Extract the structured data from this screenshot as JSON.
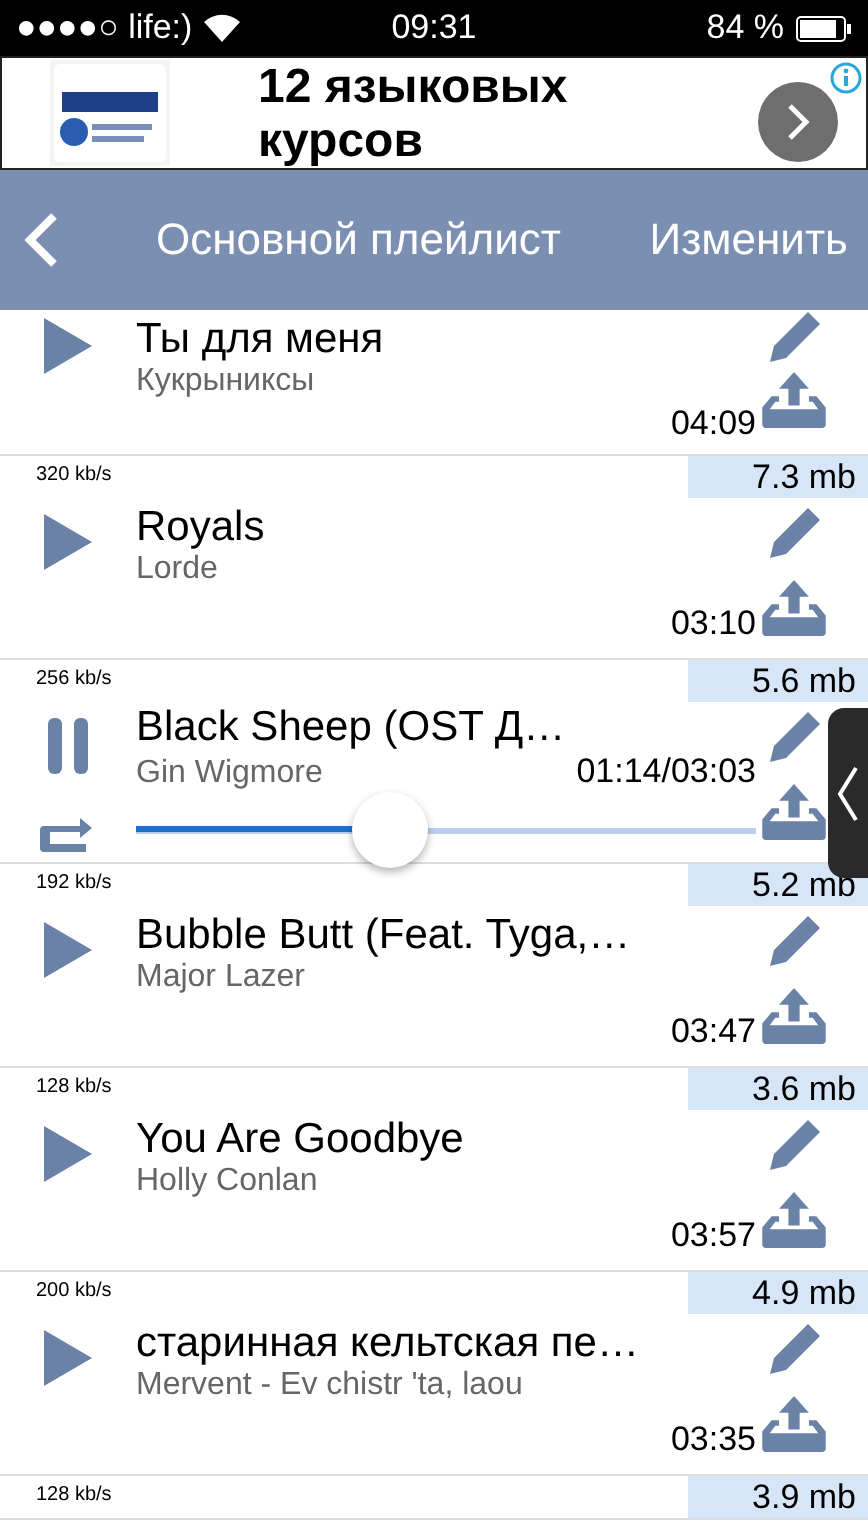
{
  "status_bar": {
    "carrier": "●●●●○ life:)",
    "time": "09:31",
    "battery": "84 %"
  },
  "ad": {
    "headline": "12 языковых курсов"
  },
  "nav": {
    "title": "Основной плейлист",
    "action": "Изменить"
  },
  "songs": [
    {
      "title": "Ты для меня",
      "artist": "Кукрыниксы",
      "time": "04:09",
      "playing": false
    },
    {
      "bitrate": "320 kb/s",
      "size": "7.3 mb",
      "title": "Royals",
      "artist": "Lorde",
      "time": "03:10",
      "playing": false
    },
    {
      "bitrate": "256 kb/s",
      "size": "5.6 mb",
      "title": "Black Sheep (OST Д…",
      "artist": "Gin Wigmore",
      "time": "01:14/03:03",
      "playing": true,
      "level": 0.41
    },
    {
      "bitrate": "192 kb/s",
      "size": "5.2 mb",
      "title": "Bubble Butt (Feat. Tyga,…",
      "artist": "Major Lazer",
      "time": "03:47",
      "playing": false
    },
    {
      "bitrate": "128 kb/s",
      "size": "3.6 mb",
      "title": "You Are Goodbye",
      "artist": "Holly Conlan",
      "time": "03:57",
      "playing": false
    },
    {
      "bitrate": "200 kb/s",
      "size": "4.9 mb",
      "title": "старинная кельтская пе…",
      "artist": "Mervent - Ev chistr 'ta, laou",
      "time": "03:35",
      "playing": false
    },
    {
      "bitrate": "128 kb/s",
      "size": "3.9 mb"
    }
  ]
}
